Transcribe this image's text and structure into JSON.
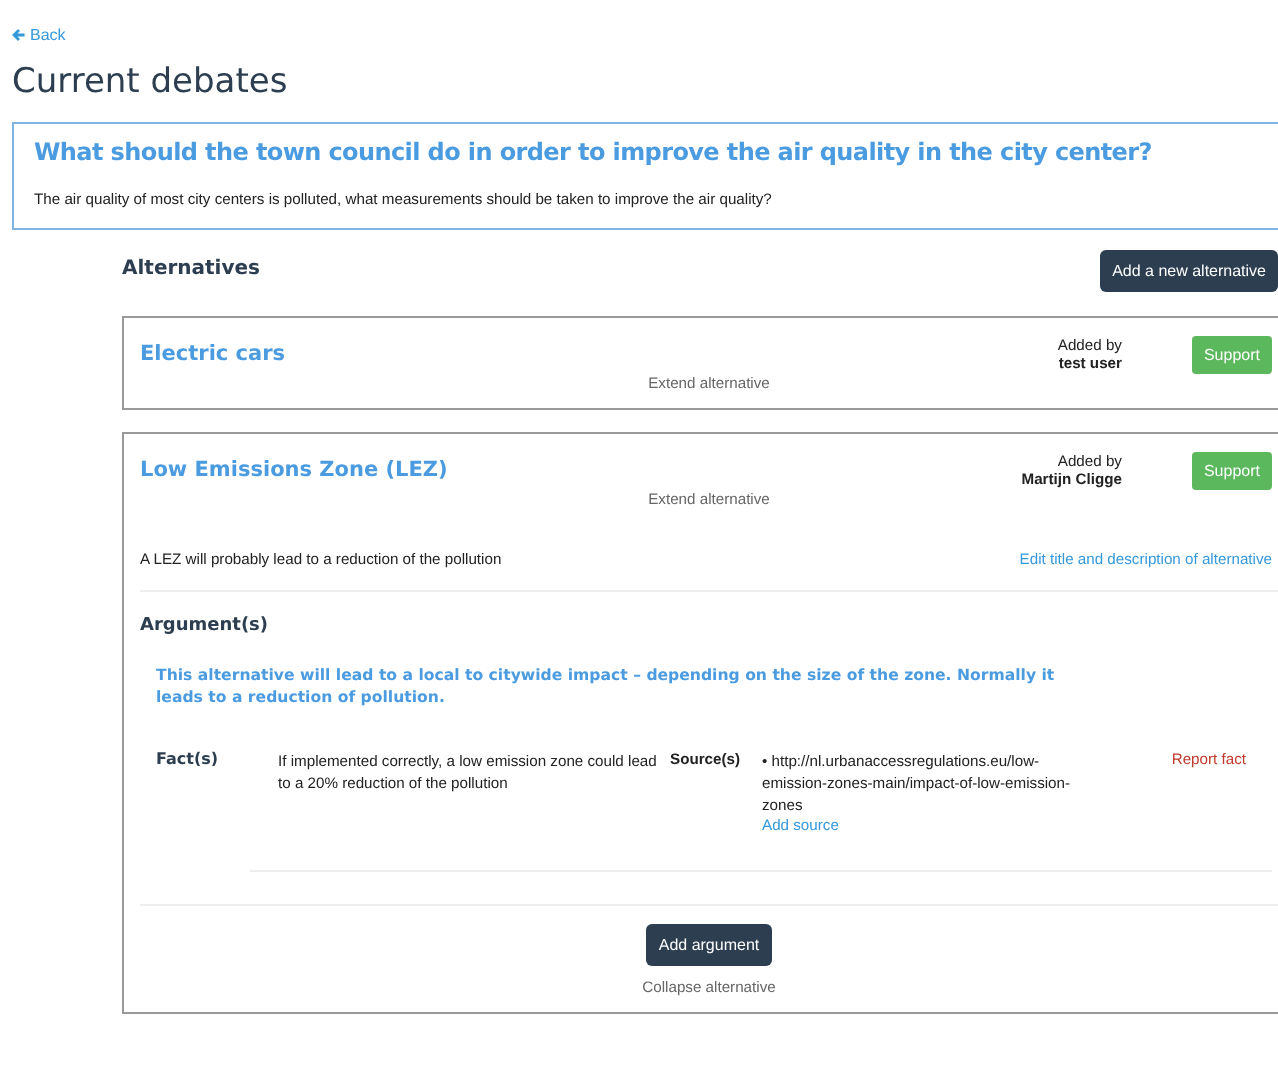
{
  "back": "Back",
  "title": "Current debates",
  "question": {
    "title": "What should the town council do in order to improve the air quality in the city center?",
    "description": "The air quality of most city centers is polluted, what measurements should be taken to improve the air quality?"
  },
  "alternatives_heading": "Alternatives",
  "add_alternative": "Add a new alternative",
  "alternatives": [
    {
      "title": "Electric cars",
      "added_by_label": "Added by",
      "author": "test user",
      "support": "Support",
      "toggle": "Extend alternative",
      "expanded": false
    },
    {
      "title": "Low Emissions Zone (LEZ)",
      "added_by_label": "Added by",
      "author": "Martijn Cligge",
      "support": "Support",
      "toggle": "Extend alternative",
      "expanded": true,
      "description": "A LEZ will probably lead to a reduction of the pollution",
      "edit": "Edit title and description of alternative",
      "arguments_heading": "Argument(s)",
      "arguments": [
        {
          "text": "This alternative will lead to a local to citywide impact – depending on the size of the zone. Normally it leads to a reduction of pollution.",
          "facts": [
            {
              "label": "Fact(s)",
              "text": "If implemented correctly, a low emission zone could lead to a 20% reduction of the pollution",
              "sources_label": "Source(s)",
              "sources": [
                "• http://nl.urbanaccessregulations.eu/low-emission-zones-main/impact-of-low-emission-zones"
              ],
              "add_source": "Add source",
              "report": "Report fact"
            }
          ]
        }
      ],
      "add_argument": "Add argument",
      "collapse": "Collapse alternative"
    }
  ]
}
